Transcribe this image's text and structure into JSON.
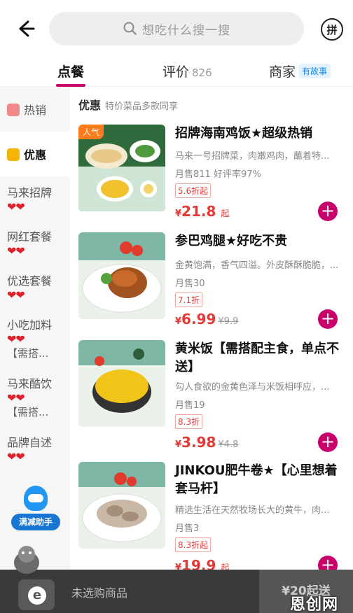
{
  "search": {
    "placeholder": "想吃什么搜一搜"
  },
  "header": {
    "group_icon": "拼"
  },
  "tabs": [
    {
      "label": "点餐"
    },
    {
      "label": "评价",
      "count": "826"
    },
    {
      "label": "商家",
      "badge": "有故事"
    }
  ],
  "sidebar": {
    "items": [
      {
        "label": "热销",
        "icon": "flame-icon"
      },
      {
        "label": "优惠",
        "icon": "coupon-icon"
      },
      {
        "label": "马来招牌",
        "hearts": "❤❤"
      },
      {
        "label": "网红套餐",
        "hearts": "❤❤"
      },
      {
        "label": "优选套餐",
        "hearts": "❤❤"
      },
      {
        "label": "小吃加料",
        "hearts": "❤❤",
        "sub": "【需搭..."
      },
      {
        "label": "马来酷饮",
        "hearts": "❤❤",
        "sub": "【需搭..."
      },
      {
        "label": "品牌自述",
        "hearts": "❤❤"
      }
    ],
    "assistant_label": "满减助手"
  },
  "section": {
    "title": "优惠",
    "desc": "特价菜品多款同享"
  },
  "dishes": [
    {
      "tag": "人气",
      "name": "招牌海南鸡饭★超级热销",
      "desc": "马来一号招牌菜，肉嫩鸡肉，蘸着特...",
      "sales": "月售811  好评率97%",
      "discount": "5.6折起",
      "price": "21.8",
      "price_suffix": "起",
      "orig": ""
    },
    {
      "name": "参巴鸡腿★好吃不贵",
      "desc": "金黄饱满，香气四溢。外皮酥酥脆脆，...",
      "sales": "月售30",
      "discount": "7.1折",
      "price": "6.99",
      "orig": "¥9.9"
    },
    {
      "name": "黄米饭【需搭配主食，单点不送】",
      "desc": "勾人食欲的金黄色泽与米饭相呼应，...",
      "sales": "月售19",
      "discount": "8.3折",
      "price": "3.98",
      "orig": "¥4.8"
    },
    {
      "name": "JINKOU肥牛卷★【心里想着套马杆】",
      "desc": "精选生活在天然牧场长大的黄牛，肉...",
      "sales": "月售3",
      "discount": "8.3折起",
      "price": "19.9",
      "price_suffix": "起",
      "orig": ""
    }
  ],
  "cart": {
    "empty_text": "未选购商品",
    "min_order": "¥20起送"
  },
  "currency": "¥",
  "watermark": "恩创网",
  "colors": {
    "accent": "#c7006b",
    "price": "#e53935",
    "hot_tag": "#ff7a1a"
  }
}
